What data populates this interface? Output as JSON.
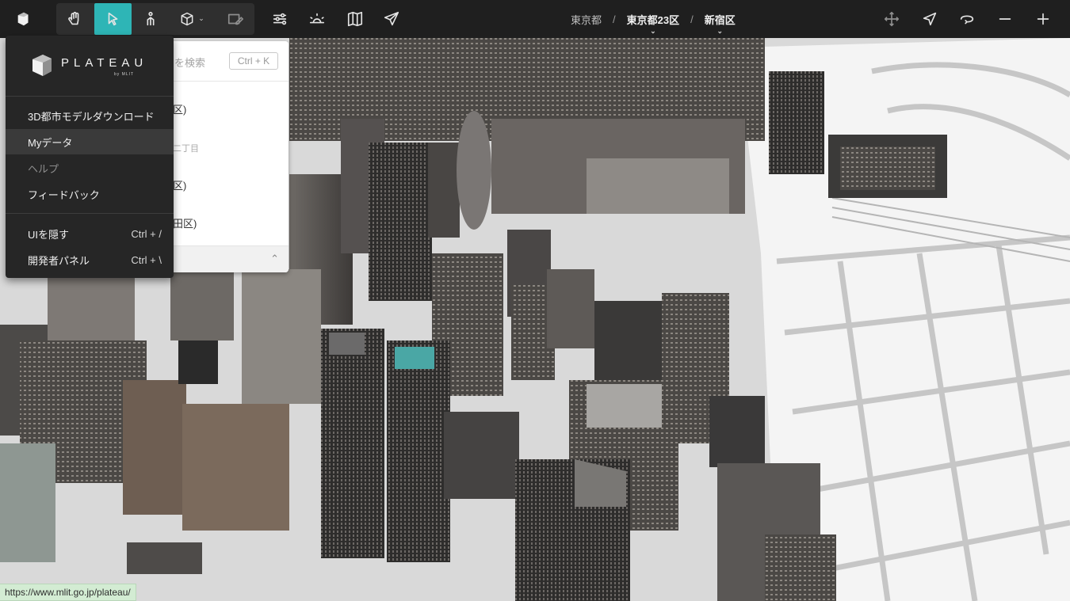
{
  "toolbar": {
    "tools": [
      {
        "name": "hand-tool-button",
        "icon": "hand-icon",
        "active": false
      },
      {
        "name": "select-tool-button",
        "icon": "cursor-icon",
        "active": true
      },
      {
        "name": "pedestrian-tool-button",
        "icon": "person-icon",
        "active": false
      },
      {
        "name": "model-tool-button",
        "icon": "cube-icon",
        "active": false
      },
      {
        "name": "sketch-tool-button",
        "icon": "sketch-icon",
        "active": false
      }
    ],
    "actions": [
      "settings-sliders-icon",
      "sun-horizon-icon",
      "map-icon",
      "share-paper-plane-icon"
    ],
    "right_controls": [
      "move-arrows-icon",
      "north-arrow-icon",
      "rotate-icon",
      "zoom-out-icon",
      "zoom-in-icon"
    ],
    "accent_color": "#2eb5b6"
  },
  "breadcrumb": {
    "items": [
      "東京都",
      "東京都23区",
      "新宿区"
    ],
    "separator": "/"
  },
  "search_panel": {
    "placeholder": "を検索",
    "shortcut": "Ctrl + K",
    "results": [
      "区)",
      "二丁目",
      "区)",
      "田区)"
    ]
  },
  "app_menu": {
    "logo": {
      "word": "PLATEAU",
      "sub": "by MLIT"
    },
    "items": [
      {
        "label": "3D都市モデルダウンロード"
      },
      {
        "label": "Myデータ"
      },
      {
        "label": "ヘルプ"
      },
      {
        "label": "フィードバック"
      },
      {
        "label": "UIを隠す",
        "shortcut": "Ctrl + /"
      },
      {
        "label": "開発者パネル",
        "shortcut": "Ctrl + \\"
      }
    ]
  },
  "status_url": "https://www.mlit.go.jp/plateau/"
}
